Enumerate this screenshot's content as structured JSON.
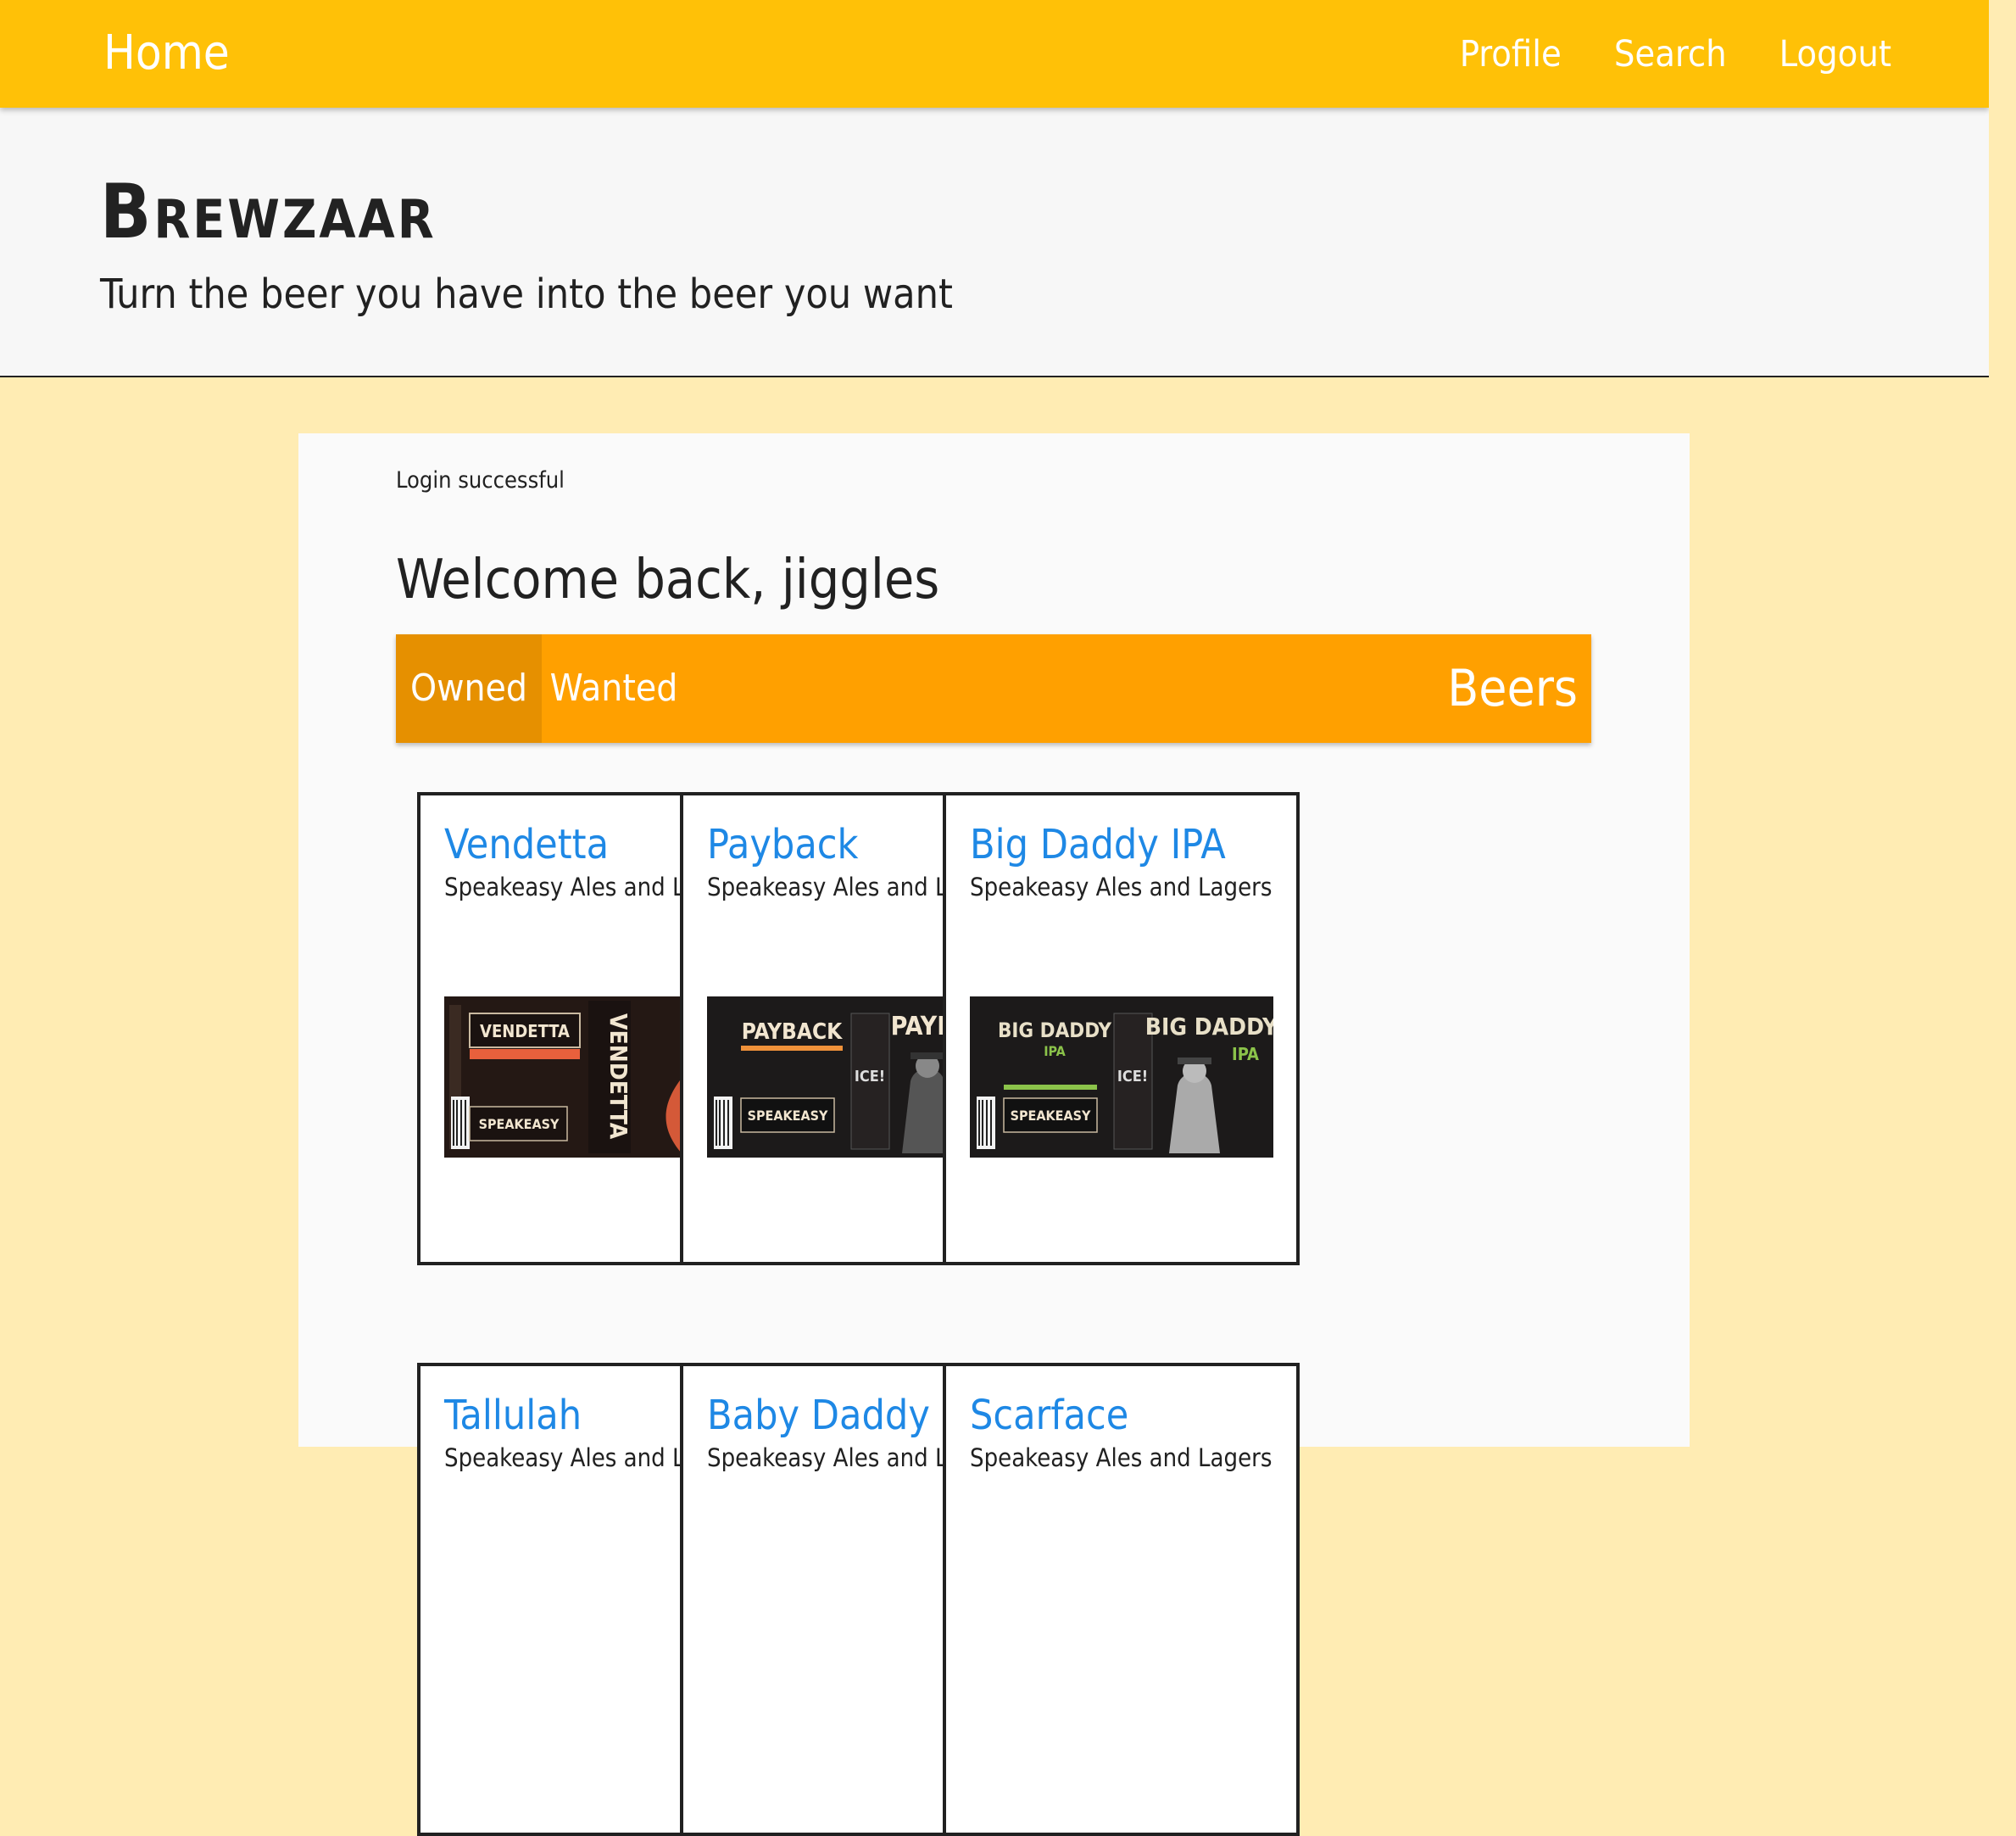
{
  "navbar": {
    "home": "Home",
    "links": [
      "Profile",
      "Search",
      "Logout"
    ]
  },
  "header": {
    "logo": "Brewzaar",
    "tagline": "Turn the beer you have into the beer you want"
  },
  "main": {
    "flash": "Login successful",
    "welcome": "Welcome back, jiggles",
    "tabs": {
      "owned": "Owned",
      "wanted": "Wanted",
      "title": "Beers"
    }
  },
  "beers": [
    {
      "name": "Vendetta",
      "brewery": "Speakeasy Ales and Lagers",
      "label": "VENDETTA",
      "accent": "#e8603c"
    },
    {
      "name": "Payback",
      "brewery": "Speakeasy Ales and Lagers",
      "label": "PAYBACK",
      "accent": "#f0923a"
    },
    {
      "name": "Big Daddy IPA",
      "brewery": "Speakeasy Ales and Lagers",
      "label": "BIG DADDY",
      "accent": "#8bc34a"
    },
    {
      "name": "Tallulah",
      "brewery": "Speakeasy Ales and Lagers"
    },
    {
      "name": "Baby Daddy",
      "brewery": "Speakeasy Ales and Lagers"
    },
    {
      "name": "Scarface",
      "brewery": "Speakeasy Ales and Lagers"
    }
  ],
  "colors": {
    "navbar": "#ffc107",
    "page_background": "#ffecb3",
    "tab_bar": "#ffa000",
    "tab_active": "#e69000",
    "beer_link": "#1e88e5"
  }
}
